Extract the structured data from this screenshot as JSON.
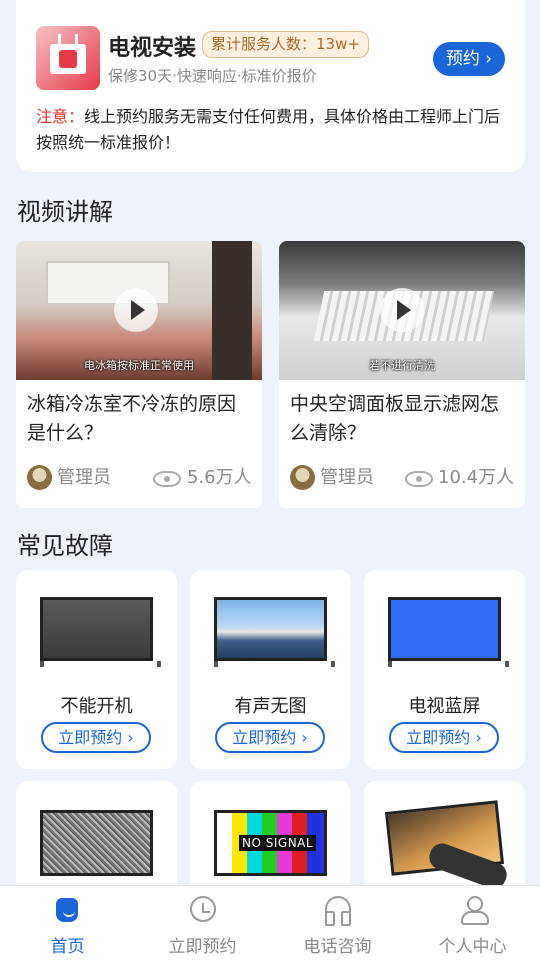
{
  "service": {
    "title": "电视安装",
    "served_badge": "累计服务人数：13w+",
    "subtitle": "保修30天·快速响应·标准价报价",
    "book_label": "预约",
    "notice_label": "注意：",
    "notice_text": "线上预约服务无需支付任何费用，具体价格由工程师上门后按照统一标准报价！"
  },
  "sections": {
    "video": "视频讲解",
    "faults": "常见故障"
  },
  "videos": [
    {
      "caption": "电冰箱按标准正常使用",
      "title": "冰箱冷冻室不冷冻的原因是什么？",
      "author": "管理员",
      "views": "5.6万人"
    },
    {
      "caption": "若不进行清洗",
      "title": "中央空调面板显示滤网怎么清除？",
      "author": "管理员",
      "views": "10.4万人"
    }
  ],
  "faults": [
    {
      "name": "不能开机",
      "button": "立即预约"
    },
    {
      "name": "有声无图",
      "button": "立即预约"
    },
    {
      "name": "电视蓝屏",
      "button": "立即预约"
    }
  ],
  "fault_row2": {
    "no_signal_text": "NO SIGNAL"
  },
  "tabbar": [
    {
      "label": "首页",
      "icon": "home-icon",
      "active": true
    },
    {
      "label": "立即预约",
      "icon": "clock-icon",
      "active": false
    },
    {
      "label": "电话咨询",
      "icon": "headset-icon",
      "active": false
    },
    {
      "label": "个人中心",
      "icon": "user-icon",
      "active": false
    }
  ],
  "colors": {
    "primary": "#1b66d6",
    "warning": "#e02c2c",
    "background": "#eef2fa"
  }
}
